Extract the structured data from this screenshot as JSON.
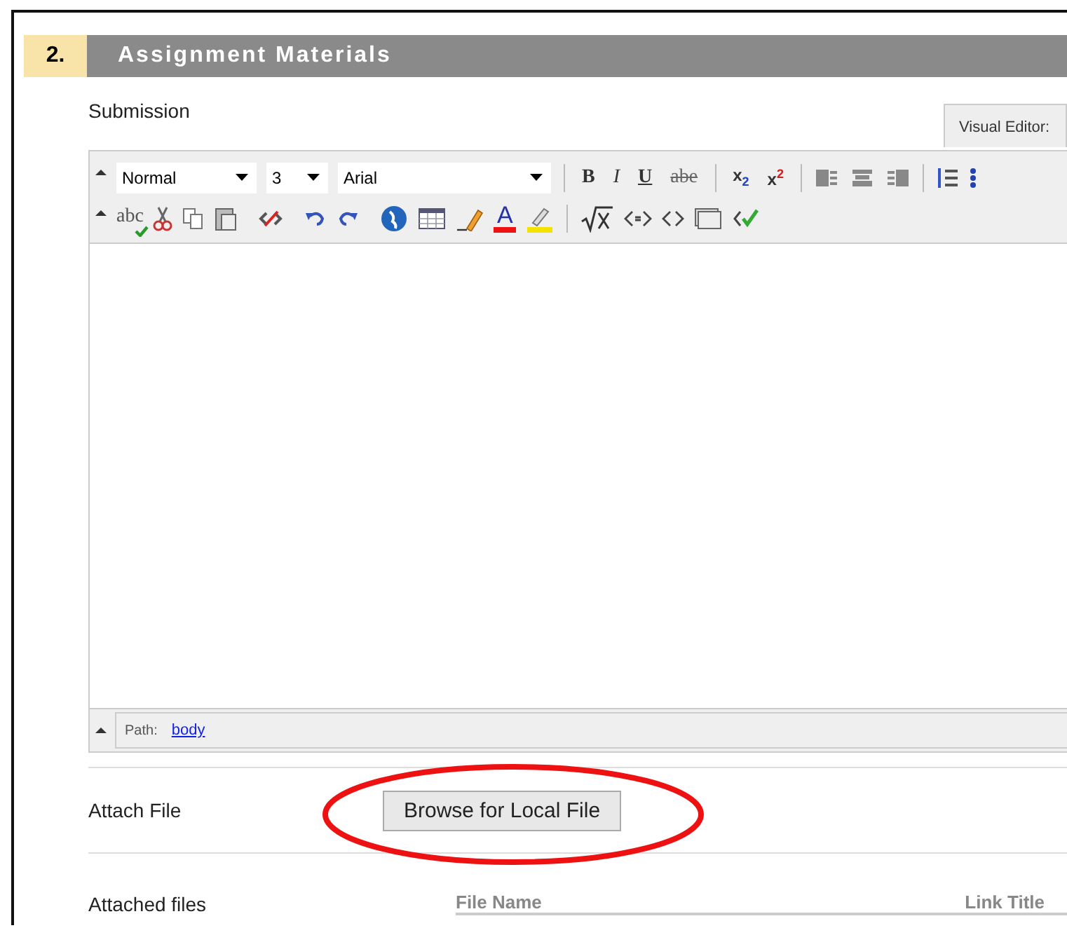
{
  "section": {
    "number": "2.",
    "title": "Assignment Materials"
  },
  "submission": {
    "label": "Submission",
    "editor_tab": "Visual Editor:",
    "dropdowns": [
      {
        "value": "Normal"
      },
      {
        "value": "3"
      },
      {
        "value": "Arial"
      }
    ],
    "format_buttons": [
      {
        "label": "B",
        "kind": "bold"
      },
      {
        "label": "I",
        "kind": "italic"
      },
      {
        "label": "U",
        "kind": "underline"
      },
      {
        "label": "abe",
        "kind": "strike"
      },
      {
        "label": "x$_{2}$",
        "kind": "sub"
      },
      {
        "label": "x$^{2}$",
        "kind": "sup"
      }
    ],
    "spell_label": "abc",
    "font_color_label": "A",
    "path_label": "Path:",
    "path_link": "body"
  },
  "attach_file": {
    "label": "Attach File",
    "button": "Browse for Local File"
  },
  "attached_files": {
    "label": "Attached files",
    "columns": [
      "File Name",
      "Link Title"
    ]
  }
}
